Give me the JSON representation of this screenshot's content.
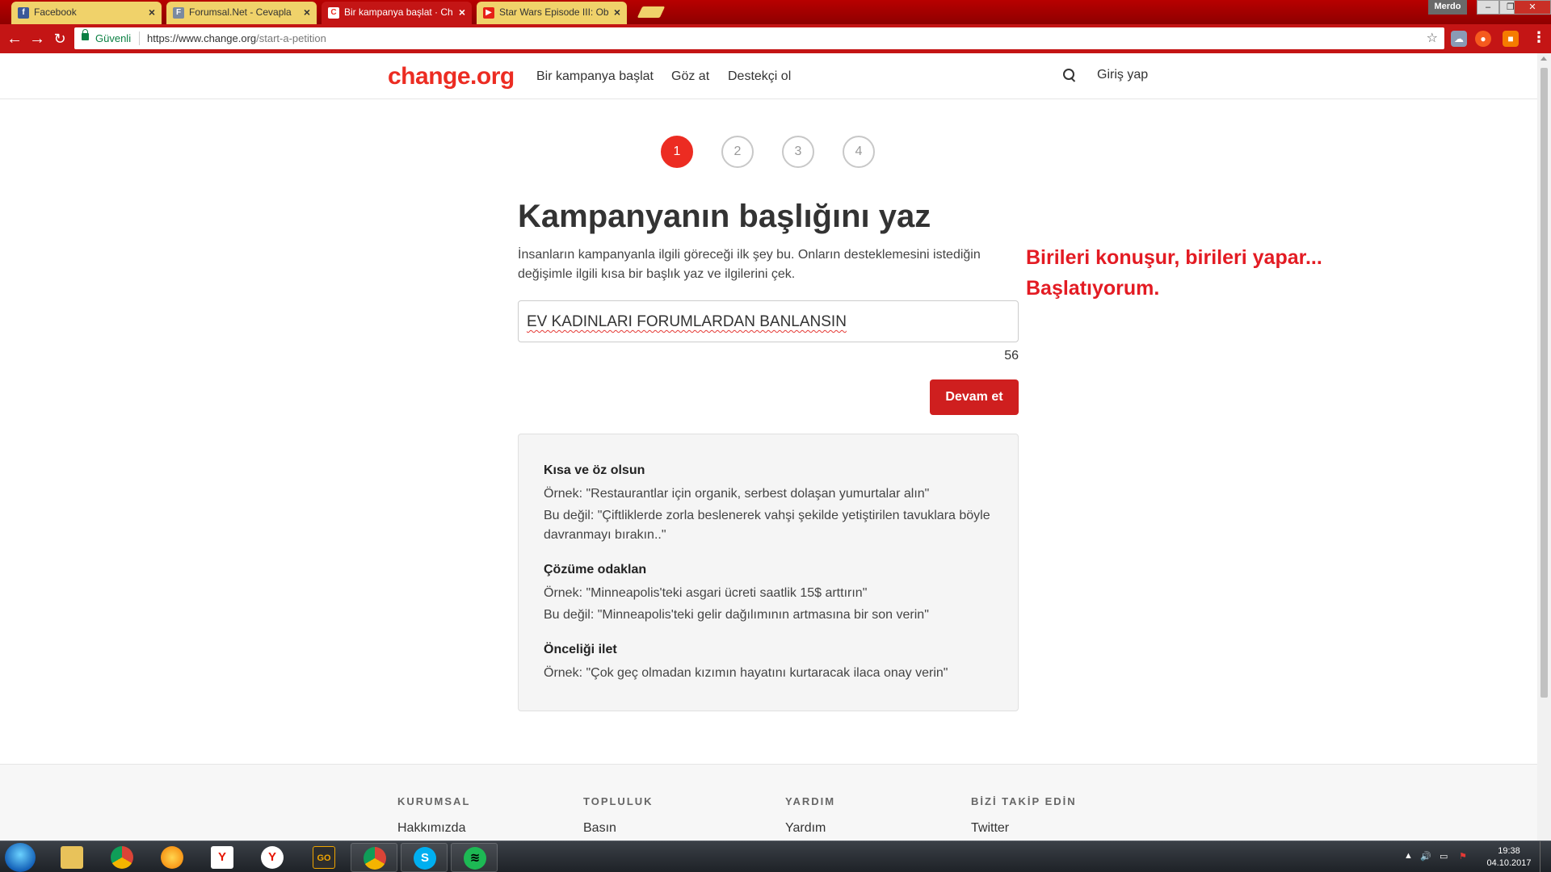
{
  "browser": {
    "tabs": [
      {
        "label": "Facebook",
        "icon": "facebook-icon",
        "color": "#3b5998"
      },
      {
        "label": "Forumsal.Net - Cevapla",
        "icon": "forum-icon",
        "color": "#7a8aa0"
      },
      {
        "label": "Bir kampanya başlat · Ch",
        "icon": "change-org-icon",
        "color": "#ec2c22",
        "active": true
      },
      {
        "label": "Star Wars Episode III: Ob",
        "icon": "youtube-icon",
        "color": "#e62117"
      }
    ],
    "profile_name": "Merdo",
    "secure_label": "Güvenli",
    "url_host": "https://www.change.org",
    "url_path": "/start-a-petition"
  },
  "site": {
    "logo": "change.org",
    "nav": [
      "Bir kampanya başlat",
      "Göz at",
      "Destekçi ol"
    ],
    "login": "Giriş yap"
  },
  "steps": [
    "1",
    "2",
    "3",
    "4"
  ],
  "active_step": 1,
  "form": {
    "title": "Kampanyanın başlığını yaz",
    "description": "İnsanların kampanyanla ilgili göreceği ilk şey bu. Onların desteklemesini istediğin değişimle ilgili kısa bir başlık yaz ve ilgilerini çek.",
    "input_value": "EV KADINLARI FORUMLARDAN BANLANSIN",
    "char_count": "56",
    "continue_label": "Devam et"
  },
  "tips": [
    {
      "heading": "Kısa ve öz olsun",
      "lines": [
        "Örnek: \"Restaurantlar için organik, serbest dolaşan yumurtalar alın\"",
        "Bu değil: \"Çiftliklerde zorla beslenerek vahşi şekilde yetiştirilen tavuklara böyle davranmayı bırakın..\""
      ]
    },
    {
      "heading": "Çözüme odaklan",
      "lines": [
        "Örnek: \"Minneapolis'teki asgari ücreti saatlik 15$ arttırın\"",
        "Bu değil: \"Minneapolis'teki gelir dağılımının artmasına bir son verin\""
      ]
    },
    {
      "heading": "Önceliği ilet",
      "lines": [
        "Örnek: \"Çok geç olmadan kızımın hayatını kurtaracak ilaca onay verin\""
      ]
    }
  ],
  "annotation": {
    "line1": "Birileri konuşur, birileri yapar...",
    "line2": "Başlatıyorum."
  },
  "footer": [
    {
      "heading": "KURUMSAL",
      "link": "Hakkımızda"
    },
    {
      "heading": "TOPLULUK",
      "link": "Basın"
    },
    {
      "heading": "YARDIM",
      "link": "Yardım"
    },
    {
      "heading": "BİZİ TAKİP EDİN",
      "link": "Twitter"
    }
  ],
  "taskbar": {
    "time": "19:38",
    "date": "04.10.2017"
  }
}
